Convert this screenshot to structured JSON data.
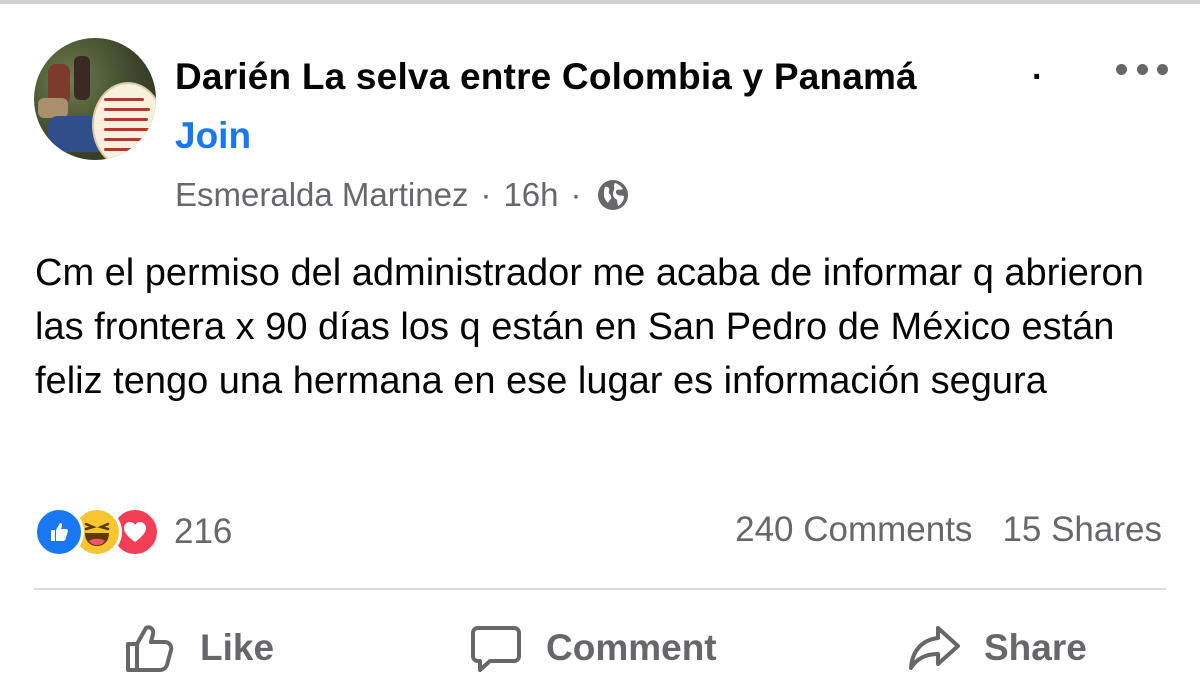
{
  "post": {
    "group_name": "Darién La selva entre Colombia y Panamá",
    "title_separator": "·",
    "join_label": "Join",
    "author": "Esmeralda Martinez",
    "time": "16h",
    "meta_separator": "·",
    "audience_icon": "globe-icon",
    "more_icon": "more-options-icon",
    "body": "Cm el permiso del administrador me acaba de informar q abrieron las frontera x 90 días los q están en San Pedro de México están feliz tengo una hermana en ese lugar es información segura"
  },
  "stats": {
    "reaction_types": [
      "like",
      "haha",
      "love"
    ],
    "reaction_count": "216",
    "comments": "240 Comments",
    "shares": "15 Shares"
  },
  "actions": {
    "like_label": "Like",
    "comment_label": "Comment",
    "share_label": "Share"
  },
  "colors": {
    "link_blue": "#1877f2",
    "secondary_text": "#65676b",
    "love_red": "#f33e58",
    "haha_yellow": "#f7c531"
  }
}
